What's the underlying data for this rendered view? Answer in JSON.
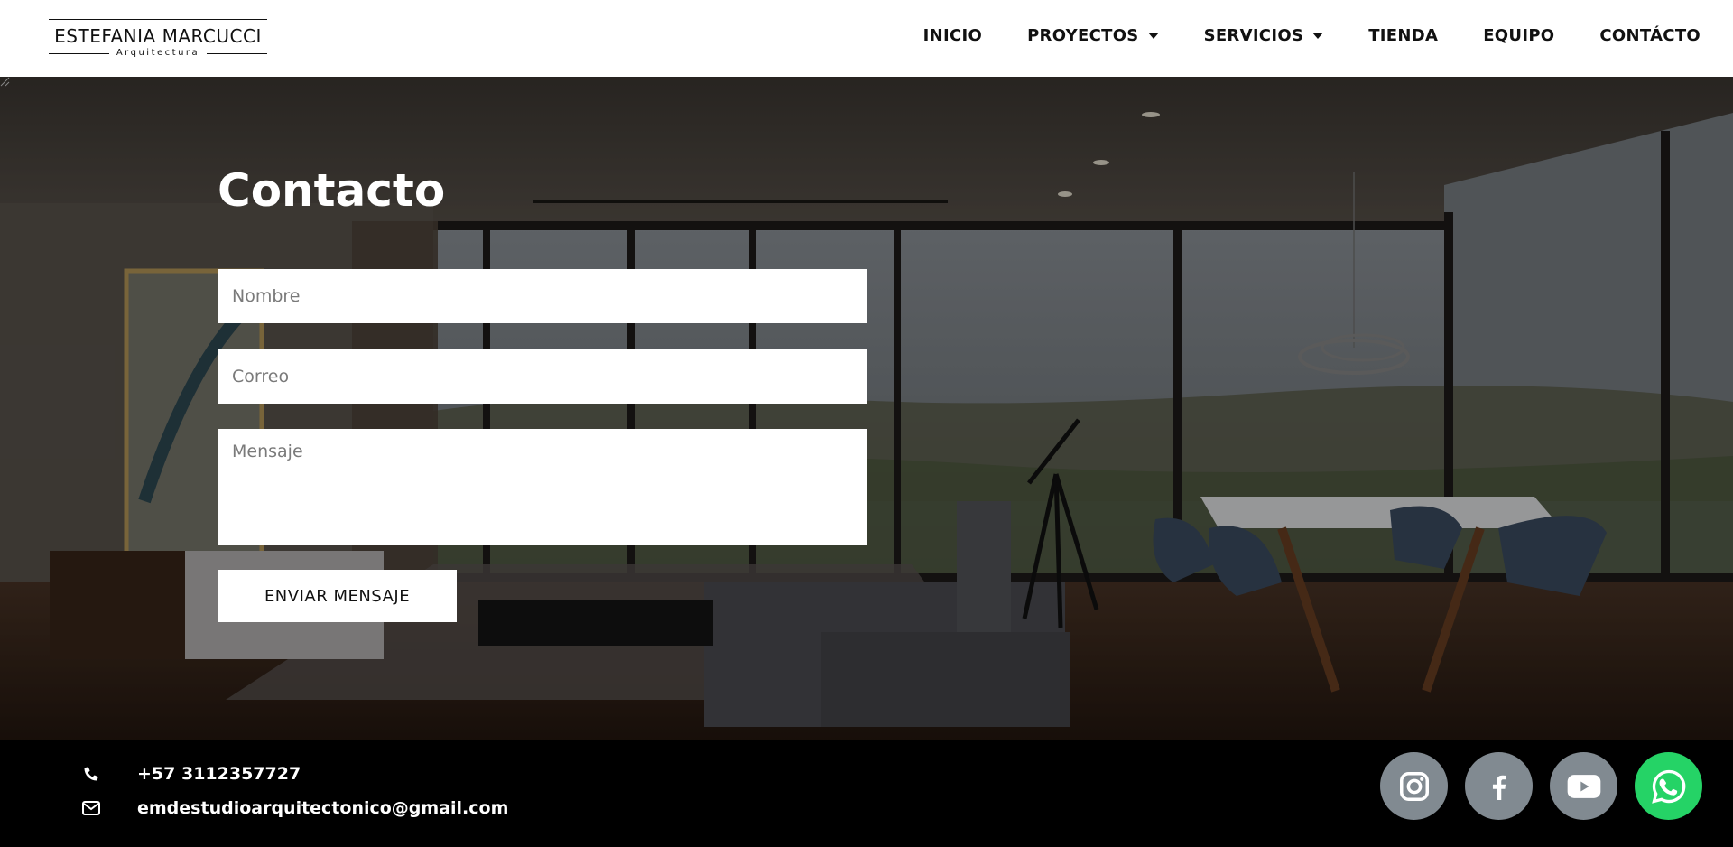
{
  "brand": {
    "name": "ESTEFANIA MARCUCCI",
    "tagline": "Arquitectura"
  },
  "nav": {
    "items": [
      {
        "label": "INICIO",
        "dropdown": false
      },
      {
        "label": "PROYECTOS",
        "dropdown": true
      },
      {
        "label": "SERVICIOS",
        "dropdown": true
      },
      {
        "label": "TIENDA",
        "dropdown": false
      },
      {
        "label": "EQUIPO",
        "dropdown": false
      },
      {
        "label": "CONTÁCTO",
        "dropdown": false
      }
    ]
  },
  "form": {
    "title": "Contacto",
    "name_placeholder": "Nombre",
    "email_placeholder": "Correo",
    "message_placeholder": "Mensaje",
    "submit_label": "ENVIAR MENSAJE"
  },
  "footer": {
    "phone": "+57 3112357727",
    "email": "emdestudioarquitectonico@gmail.com",
    "socials": [
      {
        "name": "instagram-icon",
        "color": "#818a91"
      },
      {
        "name": "facebook-icon",
        "color": "#818a91"
      },
      {
        "name": "youtube-icon",
        "color": "#818a91"
      },
      {
        "name": "whatsapp-icon",
        "color": "#25d366"
      }
    ]
  }
}
